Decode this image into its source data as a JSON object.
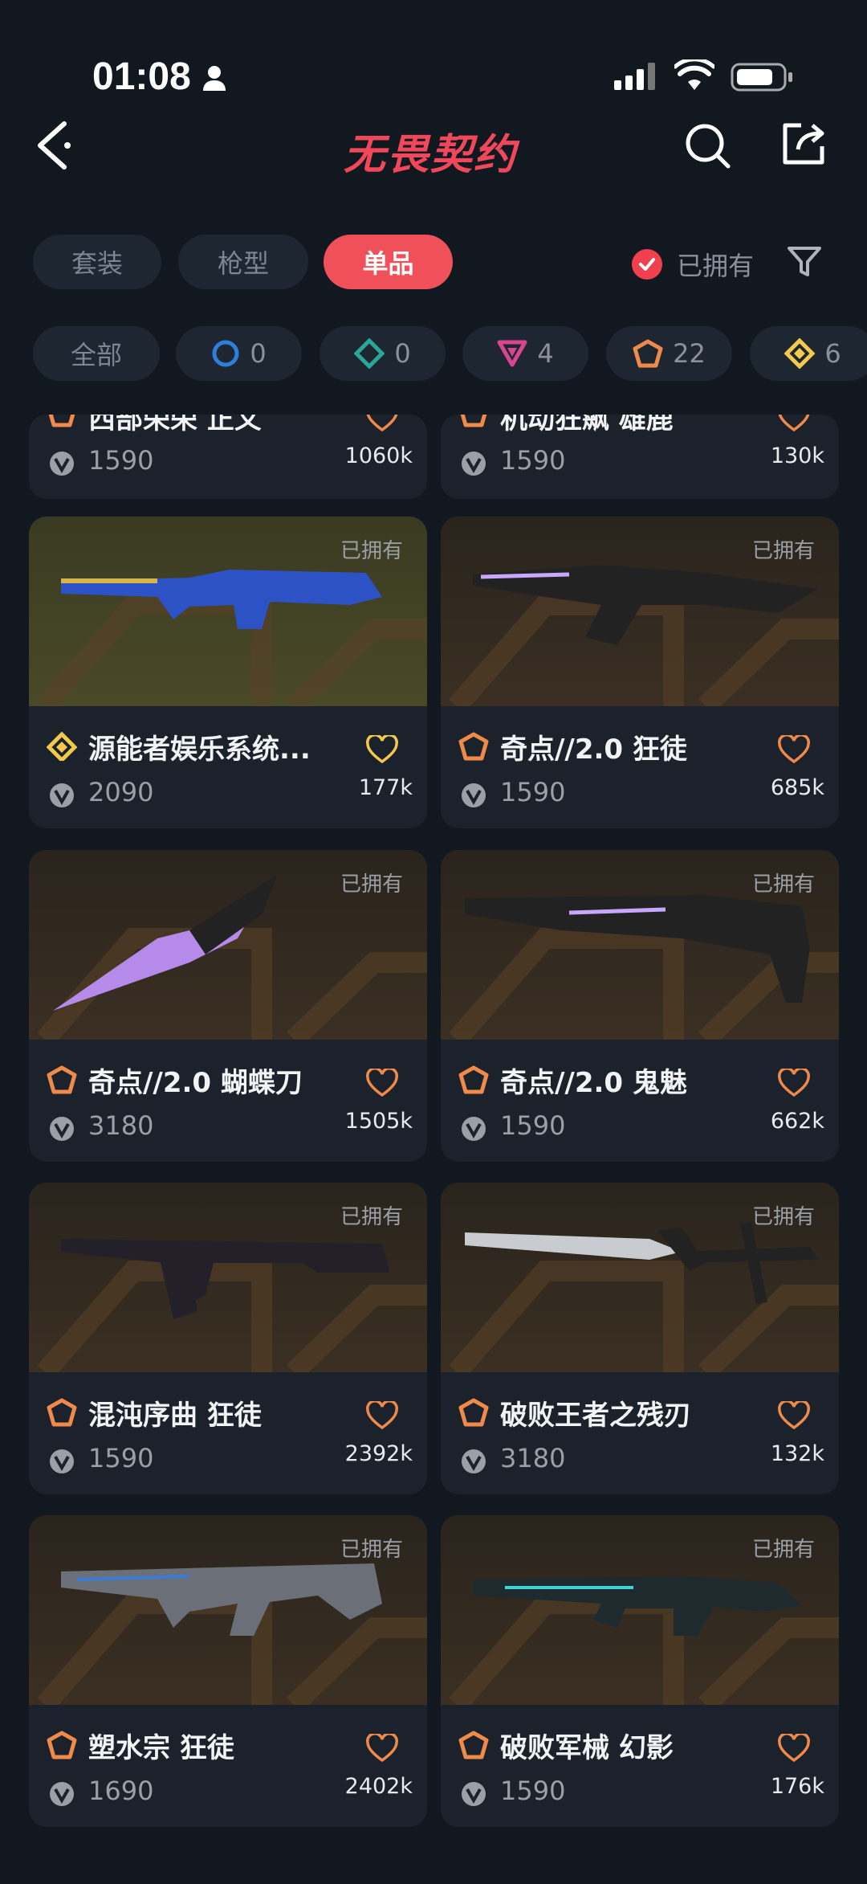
{
  "status_bar": {
    "time": "01:08"
  },
  "header": {
    "logo_text": "无畏契约"
  },
  "tabs": [
    {
      "label": "套装",
      "active": false
    },
    {
      "label": "枪型",
      "active": false
    },
    {
      "label": "单品",
      "active": true
    }
  ],
  "owned_filter": {
    "label": "已拥有",
    "checked": true
  },
  "rarity_chips": [
    {
      "label": "全部",
      "icon": "all"
    },
    {
      "count": "0",
      "icon": "select-tier-icon",
      "color": "#2f7fd8"
    },
    {
      "count": "0",
      "icon": "deluxe-tier-icon",
      "color": "#2aa597"
    },
    {
      "count": "4",
      "icon": "premium-tier-icon",
      "color": "#d9468f"
    },
    {
      "count": "22",
      "icon": "exclusive-tier-icon",
      "color": "#f08a4b"
    },
    {
      "count": "6",
      "icon": "ultra-tier-icon",
      "color": "#f2c94c"
    }
  ],
  "partial_items": [
    {
      "name": "西部荣荣 正义",
      "price": "1590",
      "likes": "1060k"
    },
    {
      "name": "机动狂飙 雄鹿",
      "price": "1590",
      "likes": "130k"
    }
  ],
  "items": [
    {
      "name": "源能者娱乐系统...",
      "price": "2090",
      "likes": "177k",
      "owned": "已拥有",
      "tier": "ultra",
      "tier_color": "#f2c94c"
    },
    {
      "name": "奇点//2.0 狂徒",
      "price": "1590",
      "likes": "685k",
      "owned": "已拥有",
      "tier": "exclusive",
      "tier_color": "#f08a4b"
    },
    {
      "name": "奇点//2.0 蝴蝶刀",
      "price": "3180",
      "likes": "1505k",
      "owned": "已拥有",
      "tier": "exclusive",
      "tier_color": "#f08a4b"
    },
    {
      "name": "奇点//2.0 鬼魅",
      "price": "1590",
      "likes": "662k",
      "owned": "已拥有",
      "tier": "exclusive",
      "tier_color": "#f08a4b"
    },
    {
      "name": "混沌序曲 狂徒",
      "price": "1590",
      "likes": "2392k",
      "owned": "已拥有",
      "tier": "exclusive",
      "tier_color": "#f08a4b"
    },
    {
      "name": "破败王者之残刃",
      "price": "3180",
      "likes": "132k",
      "owned": "已拥有",
      "tier": "exclusive",
      "tier_color": "#f08a4b"
    },
    {
      "name": "塑水宗 狂徒",
      "price": "1690",
      "likes": "2402k",
      "owned": "已拥有",
      "tier": "exclusive",
      "tier_color": "#f08a4b"
    },
    {
      "name": "破败军械 幻影",
      "price": "1590",
      "likes": "176k",
      "owned": "已拥有",
      "tier": "exclusive",
      "tier_color": "#f08a4b"
    }
  ],
  "colors": {
    "accent": "#f0505a",
    "background": "#111820",
    "card": "#1b222b",
    "heart": "#f08a4b"
  }
}
